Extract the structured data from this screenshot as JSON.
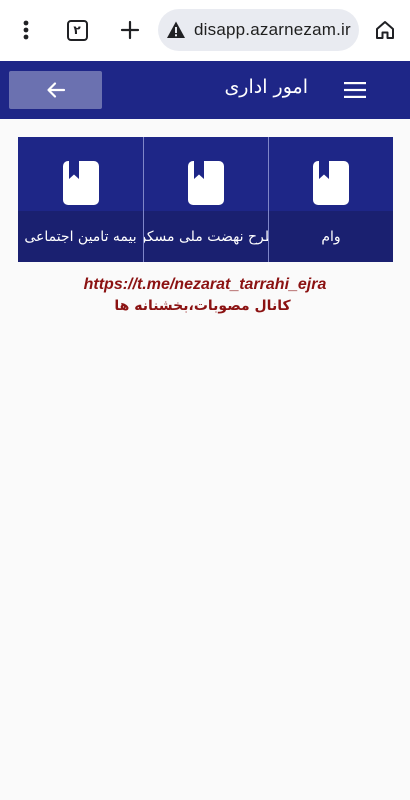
{
  "browser": {
    "url": "disapp.azarnezam.ir",
    "url_faded": "",
    "tab_count": "۲",
    "icons": {
      "menu": "more-vert-icon",
      "new_tab": "plus-icon",
      "security": "warning-icon",
      "home": "home-icon"
    }
  },
  "header": {
    "title": "امور اداری",
    "back_icon": "arrow-left-icon",
    "menu_icon": "hamburger-icon",
    "color": "#1e2687"
  },
  "tiles": [
    {
      "label": "وام",
      "icon": "bookmark-book-icon"
    },
    {
      "label": "طرح نهضت ملی مسکن",
      "icon": "bookmark-book-icon"
    },
    {
      "label": "بیمه تامین اجتماعی",
      "icon": "bookmark-book-icon"
    }
  ],
  "watermark": {
    "link": "https://t.me/nezarat_tarrahi_ejra",
    "caption": "کانال مصوبات،بخشنانه ها",
    "color": "#8b1212"
  }
}
